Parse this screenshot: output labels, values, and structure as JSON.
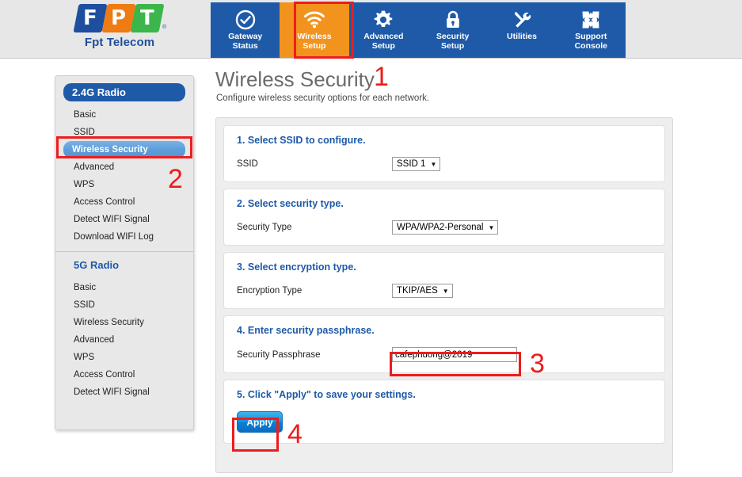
{
  "brand": {
    "logo_letters": [
      "F",
      "P",
      "T"
    ],
    "registered_mark": "®",
    "name": "Fpt Telecom"
  },
  "navbar": {
    "items": [
      {
        "label": "Gateway\nStatus",
        "icon": "check-circle-icon",
        "active": false
      },
      {
        "label": "Wireless\nSetup",
        "icon": "wifi-icon",
        "active": true
      },
      {
        "label": "Advanced\nSetup",
        "icon": "gear-icon",
        "active": false
      },
      {
        "label": "Security\nSetup",
        "icon": "lock-icon",
        "active": false
      },
      {
        "label": "Utilities",
        "icon": "tools-icon",
        "active": false
      },
      {
        "label": "Support\nConsole",
        "icon": "compress-arrows-icon",
        "active": false
      }
    ],
    "active_color": "#f2931d",
    "bar_color": "#1e5aa8"
  },
  "sidebar": {
    "groups": [
      {
        "title": "2.4G Radio",
        "style": "filled",
        "items": [
          {
            "label": "Basic",
            "selected": false
          },
          {
            "label": "SSID",
            "selected": false
          },
          {
            "label": "Wireless Security",
            "selected": true
          },
          {
            "label": "Advanced",
            "selected": false
          },
          {
            "label": "WPS",
            "selected": false
          },
          {
            "label": "Access Control",
            "selected": false
          },
          {
            "label": "Detect WIFI Signal",
            "selected": false
          },
          {
            "label": "Download WIFI Log",
            "selected": false
          }
        ]
      },
      {
        "title": "5G Radio",
        "style": "plain",
        "items": [
          {
            "label": "Basic",
            "selected": false
          },
          {
            "label": "SSID",
            "selected": false
          },
          {
            "label": "Wireless Security",
            "selected": false
          },
          {
            "label": "Advanced",
            "selected": false
          },
          {
            "label": "WPS",
            "selected": false
          },
          {
            "label": "Access Control",
            "selected": false
          },
          {
            "label": "Detect WIFI Signal",
            "selected": false
          }
        ]
      }
    ]
  },
  "main": {
    "title": "Wireless Security",
    "subtitle": "Configure wireless security options for each network.",
    "sections": [
      {
        "heading": "1. Select SSID to configure.",
        "field_label": "SSID",
        "control": "select",
        "value": "SSID 1",
        "caret": "▼"
      },
      {
        "heading": "2. Select security type.",
        "field_label": "Security Type",
        "control": "select",
        "value": "WPA/WPA2-Personal",
        "caret": "▼"
      },
      {
        "heading": "3. Select encryption type.",
        "field_label": "Encryption Type",
        "control": "select",
        "value": "TKIP/AES",
        "caret": "▼"
      },
      {
        "heading": "4. Enter security passphrase.",
        "field_label": "Security Passphrase",
        "control": "text",
        "value": "cafephuong@2019",
        "placeholder": ""
      },
      {
        "heading": "5. Click \"Apply\" to save your settings.",
        "control": "button",
        "button_label": "Apply"
      }
    ]
  },
  "annotations": {
    "color": "#ee1c1c",
    "numbers": [
      "1",
      "2",
      "3",
      "4"
    ]
  }
}
